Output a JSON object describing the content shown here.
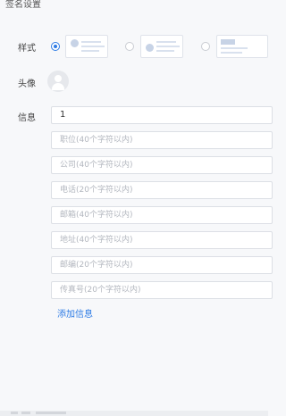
{
  "header": {
    "title": "签名设置"
  },
  "style_row": {
    "label": "样式",
    "options": [
      {
        "name": "style-1",
        "selected": true
      },
      {
        "name": "style-2",
        "selected": false
      },
      {
        "name": "style-3",
        "selected": false
      }
    ]
  },
  "avatar_row": {
    "label": "头像"
  },
  "info_row": {
    "label": "信息",
    "name_value": "1",
    "fields": [
      {
        "placeholder": "职位(40个字符以内)"
      },
      {
        "placeholder": "公司(40个字符以内)"
      },
      {
        "placeholder": "电话(20个字符以内)"
      },
      {
        "placeholder": "邮箱(40个字符以内)"
      },
      {
        "placeholder": "地址(40个字符以内)"
      },
      {
        "placeholder": "邮编(20个字符以内)"
      },
      {
        "placeholder": "传真号(20个字符以内)"
      }
    ],
    "add_link": "添加信息"
  },
  "colors": {
    "accent": "#2d7be5",
    "background": "#f7f8fa",
    "border": "#dcdfe5"
  },
  "icons": {
    "avatar": "user-avatar-icon"
  }
}
